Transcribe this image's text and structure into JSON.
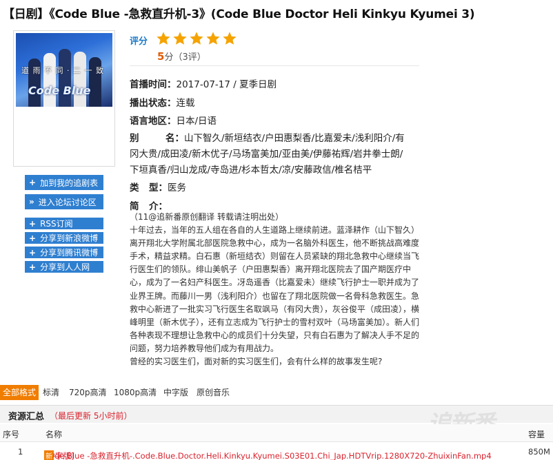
{
  "page": {
    "title": "【日剧】《Code Blue -急救直升机-3》(Code Blue Doctor Heli Kinkyu Kyumei 3)"
  },
  "poster": {
    "banner_text": "道 雨 不 同 · 二 一 致",
    "logo_text": "Code Blue"
  },
  "sidebar": {
    "buttons": [
      {
        "icon": "+",
        "label": "加到我的追剧表"
      },
      {
        "icon": "»",
        "label": "进入论坛讨论区"
      },
      {
        "icon": "+",
        "label": "RSS订阅"
      },
      {
        "icon": "+",
        "label": "分享到新浪微博"
      },
      {
        "icon": "+",
        "label": "分享到腾讯微博"
      },
      {
        "icon": "+",
        "label": "分享到人人网"
      }
    ]
  },
  "rating": {
    "label": "评分",
    "stars": 5,
    "score": "5",
    "score_unit": "分",
    "count": "（3评）",
    "star_color": "#f5a300"
  },
  "info": {
    "premiere_label": "首播时间：",
    "premiere_value": "2017-07-17 / 夏季日剧",
    "status_label": "播出状态：",
    "status_value": "连载",
    "region_label": "语言地区：",
    "region_value": "日本/日语",
    "alias_label": "别名：",
    "alias_line1": "山下智久/新垣结衣/户田惠梨香/比嘉爱未/浅利阳介/有",
    "alias_line2": "冈大贵/成田凌/新木优子/马场富美加/亚由美/伊藤祐辉/岩井拳士朗/",
    "alias_line3": "下垣真香/归山龙成/寺岛进/杉本哲太/凉/安藤政信/椎名桔平",
    "genre_label": "类型：",
    "genre_value": "医务",
    "intro_label": "简介："
  },
  "intro": {
    "note": "（11@追新番原创翻译 转载请注明出处）",
    "body": "十年过去，当年的五人组在各自的人生道路上继续前进。蓝泽耕作（山下智久）离开翔北大学附属北部医院急救中心，成为一名脑外科医生，他不断挑战高难度手术，精益求精。白石惠（新垣结衣）则留在人员紧缺的翔北急救中心继续当飞行医生们的领队。绯山美帆子（户田惠梨香）离开翔北医院去了国产期医疗中心，成为了一名妇产科医生。冴岛遥香（比嘉爱未）继续飞行护士一职并成为了业界王牌。而藤川一男（浅利阳介）也留在了翔北医院做一名骨科急救医生。急救中心新进了一批实习飞行医生名取飒马（有冈大贵），灰谷俊平（成田凌），横峰明里（新木优子），还有立志成为飞行护士的雪村双叶（马场富美加）。新人们各种表现不理想让急救中心的成员们十分失望，只有白石惠为了解决人手不足的问题，努力培养教导他们成为有用战力。",
    "closing": "曾经的实习医生们，面对新的实习医生们，会有什么样的故事发生呢?"
  },
  "tabs": [
    "全部格式",
    "标清",
    "720p高清",
    "1080p高清",
    "中字版",
    "原创音乐"
  ],
  "resources": {
    "title": "资源汇总",
    "update": "（最后更新 5小时前）",
    "col_index": "序号",
    "col_name": "名称",
    "col_size": "容量",
    "rows": [
      {
        "index": "1",
        "name": "Code Blue -急救直升机-.Code.Blue.Doctor.Heli.Kinkyu.Kyumei.S03E01.Chi_Jap.HDTVrip.1280X720-ZhuixinFan.mp4",
        "tag": "[中字版]",
        "new_badge": "新",
        "size": "850M"
      }
    ]
  },
  "watermark": "ZhuixinFan"
}
